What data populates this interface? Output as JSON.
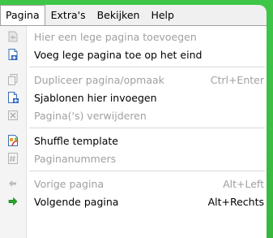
{
  "menubar": {
    "items": [
      {
        "label": "Pagina",
        "active": true
      },
      {
        "label": "Extra's",
        "active": false
      },
      {
        "label": "Bekijken",
        "active": false
      },
      {
        "label": "Help",
        "active": false
      }
    ]
  },
  "menu": {
    "items": [
      {
        "label": "Hier een lege pagina toevoegen",
        "shortcut": "",
        "enabled": false,
        "icon": "insert-page-icon"
      },
      {
        "label": "Voeg lege pagina toe op het eind",
        "shortcut": "",
        "enabled": true,
        "icon": "append-page-icon"
      },
      {
        "label": "Dupliceer pagina/opmaak",
        "shortcut": "Ctrl+Enter",
        "enabled": false,
        "icon": "duplicate-page-icon"
      },
      {
        "label": "Sjablonen hier invoegen",
        "shortcut": "",
        "enabled": true,
        "icon": "template-insert-icon"
      },
      {
        "label": "Pagina('s) verwijderen",
        "shortcut": "",
        "enabled": false,
        "icon": "delete-page-icon"
      },
      {
        "label": "Shuffle template",
        "shortcut": "",
        "enabled": true,
        "icon": "shuffle-template-icon"
      },
      {
        "label": "Paginanummers",
        "shortcut": "",
        "enabled": false,
        "icon": "page-numbers-icon"
      },
      {
        "label": "Vorige pagina",
        "shortcut": "Alt+Left",
        "enabled": false,
        "icon": "previous-arrow-icon"
      },
      {
        "label": "Volgende pagina",
        "shortcut": "Alt+Rechts",
        "enabled": true,
        "icon": "next-arrow-icon"
      }
    ]
  },
  "colors": {
    "frame_green": "#3dbf45",
    "disabled_text": "#a0a0a0",
    "next_arrow": "#2aa52a"
  }
}
